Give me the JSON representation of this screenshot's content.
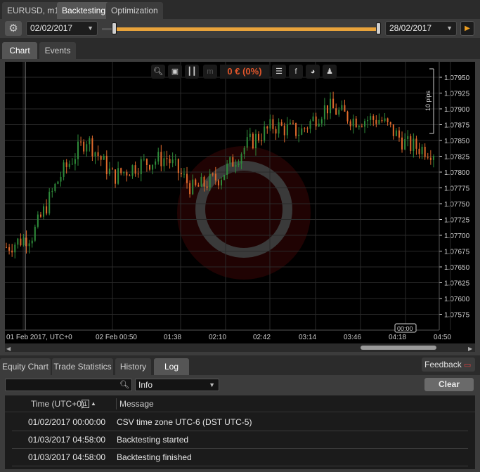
{
  "top_tabs": {
    "symbol": "EURUSD, m1",
    "backtesting": "Backtesting",
    "optimization": "Optimization"
  },
  "toolbar": {
    "start_date": "02/02/2017",
    "end_date": "28/02/2017"
  },
  "chart_tabs": {
    "chart": "Chart",
    "events": "Events"
  },
  "chart": {
    "pnl": "0 € (0%)",
    "pips_label": "10 pips",
    "cursor_time": "00:00",
    "colors": {
      "up": "#2e8b3a",
      "down": "#e06a2c",
      "grid": "#2a2a2a",
      "axis": "#cfcfcf"
    },
    "price_labels": [
      "1.07950",
      "1.07925",
      "1.07900",
      "1.07875",
      "1.07850",
      "1.07825",
      "1.07800",
      "1.07775",
      "1.07750",
      "1.07725",
      "1.07700",
      "1.07675",
      "1.07650",
      "1.07625",
      "1.07600",
      "1.07575"
    ],
    "time_labels": [
      "01 Feb 2017, UTC+0",
      "02 Feb 00:50",
      "01:38",
      "02:10",
      "02:42",
      "03:14",
      "03:46",
      "04:18",
      "04:50"
    ]
  },
  "chart_data": {
    "type": "line",
    "title": "",
    "xlabel": "",
    "ylabel": "",
    "x": [
      "00:10",
      "00:30",
      "00:50",
      "01:10",
      "01:38",
      "02:00",
      "02:10",
      "02:25",
      "02:42",
      "03:00",
      "03:14",
      "03:30",
      "03:46",
      "04:00",
      "04:18",
      "04:35",
      "04:50"
    ],
    "series": [
      {
        "values": [
          1.0768,
          1.077,
          1.0779,
          1.0785,
          1.0779,
          1.0781,
          1.0782,
          1.0777,
          1.0779,
          1.0784,
          1.0787,
          1.0786,
          1.079,
          1.0788,
          1.0788,
          1.0784,
          1.0783
        ]
      }
    ],
    "ylim": [
      1.0755,
      1.0797
    ]
  },
  "bottom_tabs": {
    "equity": "Equity Chart",
    "trade_stats": "Trade Statistics",
    "history": "History",
    "log": "Log",
    "feedback": "Feedback"
  },
  "log": {
    "level": "Info",
    "clear": "Clear",
    "col_time": "Time (UTC+0)",
    "sort_badge": "1",
    "col_message": "Message",
    "rows": [
      {
        "time": "01/02/2017 00:00:00",
        "message": "CSV time zone UTC-6 (DST UTC-5)"
      },
      {
        "time": "01/03/2017 04:58:00",
        "message": "Backtesting started"
      },
      {
        "time": "01/03/2017 04:58:00",
        "message": "Backtesting finished"
      }
    ]
  }
}
